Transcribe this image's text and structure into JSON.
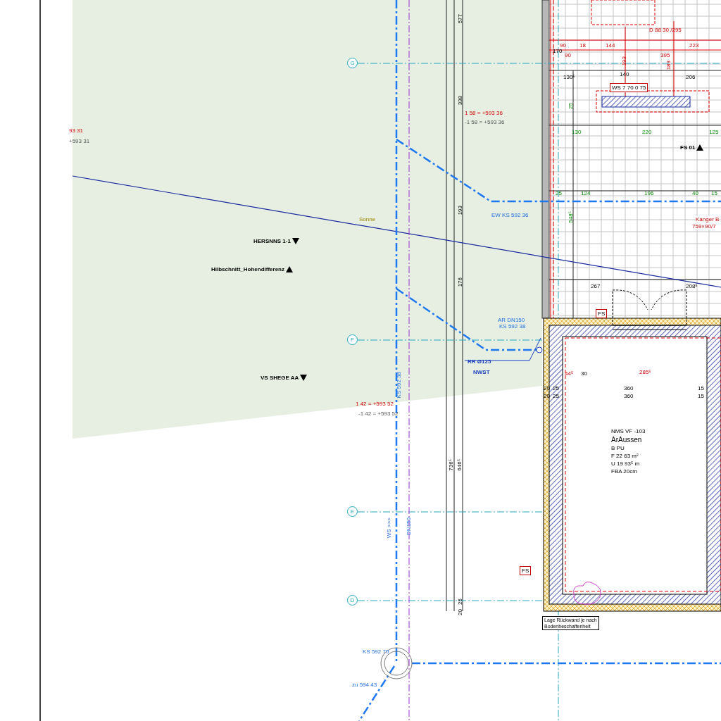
{
  "axes": [
    {
      "label": "G"
    },
    {
      "label": "F"
    },
    {
      "label": "E"
    },
    {
      "label": "D"
    }
  ],
  "labels": [
    {
      "text": "D 88 30 /295",
      "kind": "dim_red"
    },
    {
      "text": "90",
      "kind": "dim_red"
    },
    {
      "text": "18",
      "kind": "dim_red"
    },
    {
      "text": "144",
      "kind": "dim_red"
    },
    {
      "text": "223",
      "kind": "dim_red"
    },
    {
      "text": "170",
      "kind": "dim"
    },
    {
      "text": "90",
      "kind": "dim_red"
    },
    {
      "text": "395",
      "kind": "dim_red"
    },
    {
      "text": "193",
      "kind": "dim_red"
    },
    {
      "text": "183",
      "kind": "dim_red"
    },
    {
      "text": "577",
      "kind": "dim"
    },
    {
      "text": "130⁵",
      "kind": "dim"
    },
    {
      "text": "140",
      "kind": "dim"
    },
    {
      "text": "206",
      "kind": "dim"
    },
    {
      "text": "WS 7 70 0 75",
      "kind": "tag_red"
    },
    {
      "text": "25",
      "kind": "dim_green"
    },
    {
      "text": "338",
      "kind": "dim"
    },
    {
      "text": "93 31",
      "kind": "elev_red"
    },
    {
      "text": "+593 31",
      "kind": "elev_grey"
    },
    {
      "text": "1 58 = +593 36",
      "kind": "elev_red"
    },
    {
      "text": "-1 58 = +593 36",
      "kind": "elev_grey"
    },
    {
      "text": "130",
      "kind": "dim_green"
    },
    {
      "text": "220",
      "kind": "dim_green"
    },
    {
      "text": "125",
      "kind": "dim_green"
    },
    {
      "text": "FS 01",
      "kind": "level_up"
    },
    {
      "text": "25",
      "kind": "dim_green"
    },
    {
      "text": "124",
      "kind": "dim_green"
    },
    {
      "text": "196",
      "kind": "dim_green"
    },
    {
      "text": "40",
      "kind": "dim_green"
    },
    {
      "text": "15",
      "kind": "dim_green"
    },
    {
      "text": "EW  KS 592 36",
      "kind": "pipe"
    },
    {
      "text": "193",
      "kind": "dim"
    },
    {
      "text": "548⁵",
      "kind": "dim_green"
    },
    {
      "text": "Kanger B",
      "kind": "note_red"
    },
    {
      "text": "759×90/7",
      "kind": "note_red"
    },
    {
      "text": "Sonne",
      "kind": "note_yellow"
    },
    {
      "text": "HERSNNS 1-1",
      "kind": "level_down"
    },
    {
      "text": "Hilbschnitt_Hohendifferenz",
      "kind": "level_up"
    },
    {
      "text": "176",
      "kind": "dim"
    },
    {
      "text": "267",
      "kind": "dim"
    },
    {
      "text": "208⁵",
      "kind": "dim"
    },
    {
      "text": "FS",
      "kind": "tag_red"
    },
    {
      "text": "AR DN150",
      "kind": "pipe"
    },
    {
      "text": "KS 592 38",
      "kind": "pipe"
    },
    {
      "text": "RR Ø125",
      "kind": "pipe_small"
    },
    {
      "text": "NWST",
      "kind": "pipe_small"
    },
    {
      "text": "44⁵",
      "kind": "dim_red"
    },
    {
      "text": "30",
      "kind": "dim"
    },
    {
      "text": "285⁵",
      "kind": "dim_red"
    },
    {
      "text": "VS SHEGE AA",
      "kind": "level_down"
    },
    {
      "text": "20",
      "kind": "dim"
    },
    {
      "text": "25",
      "kind": "dim"
    },
    {
      "text": "360",
      "kind": "dim"
    },
    {
      "text": "15",
      "kind": "dim"
    },
    {
      "text": "20",
      "kind": "dim"
    },
    {
      "text": "25",
      "kind": "dim"
    },
    {
      "text": "360",
      "kind": "dim"
    },
    {
      "text": "15",
      "kind": "dim"
    },
    {
      "text": "KS 592 38",
      "kind": "pipe_vertical"
    },
    {
      "text": "1 42 = +593 52",
      "kind": "elev_red"
    },
    {
      "text": "-1 42 = +593 52",
      "kind": "elev_grey"
    },
    {
      "text": "736⁵",
      "kind": "dim_vertical"
    },
    {
      "text": "646⁵",
      "kind": "dim_vertical"
    },
    {
      "text": "WS >>>",
      "kind": "pipe_vertical"
    },
    {
      "text": "DN150",
      "kind": "pipe_vertical"
    },
    {
      "text": "FS",
      "kind": "tag_red"
    },
    {
      "text": "25",
      "kind": "dim_vertical"
    },
    {
      "text": "20",
      "kind": "dim_vertical"
    },
    {
      "text": "KS 592 70",
      "kind": "pipe"
    },
    {
      "text": "zu 594 43",
      "kind": "pipe"
    }
  ],
  "room": {
    "number": "NMS VF -103",
    "name": "ArAussen",
    "lines": [
      "B PU",
      "F 22 63 m²",
      "U 19 93⁵ m",
      "FBA 20cm"
    ]
  },
  "note": {
    "lines": [
      "Lage Rückwand je nach",
      "Bodenbeschaffenheit"
    ]
  }
}
